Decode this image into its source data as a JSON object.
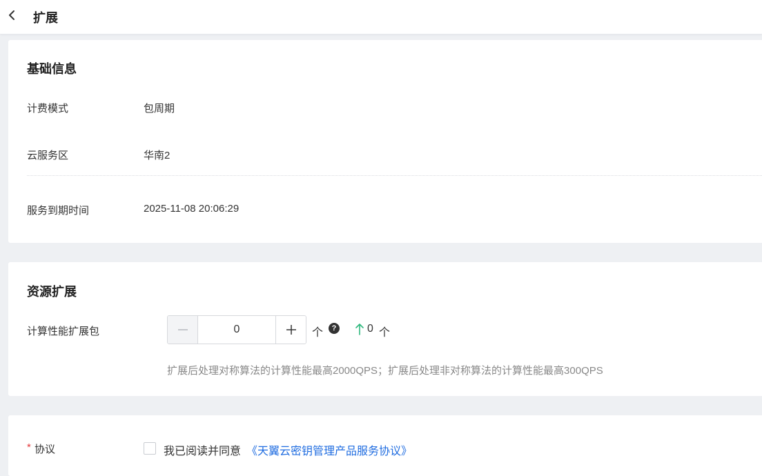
{
  "header": {
    "title": "扩展"
  },
  "basic_info": {
    "section_title": "基础信息",
    "rows": [
      {
        "label": "计费模式",
        "value": "包周期"
      },
      {
        "label": "云服务区",
        "value": "华南2"
      },
      {
        "label": "服务到期时间",
        "value": "2025-11-08 20:06:29"
      }
    ]
  },
  "resource_expansion": {
    "section_title": "资源扩展",
    "label": "计算性能扩展包",
    "stepper": {
      "value": "0",
      "minus_symbol": "−",
      "plus_symbol": "+"
    },
    "unit": "个",
    "help_symbol": "?",
    "increase_value": "0",
    "increase_unit": "个",
    "hint": "扩展后处理对称算法的计算性能最高2000QPS；扩展后处理非对称算法的计算性能最高300QPS",
    "increase_color": "#2db87d"
  },
  "agreement": {
    "required_mark": "*",
    "label": "协议",
    "agree_text": "我已阅读并同意",
    "link_text": "《天翼云密钥管理产品服务协议》",
    "link_color": "#1f6ce0"
  }
}
